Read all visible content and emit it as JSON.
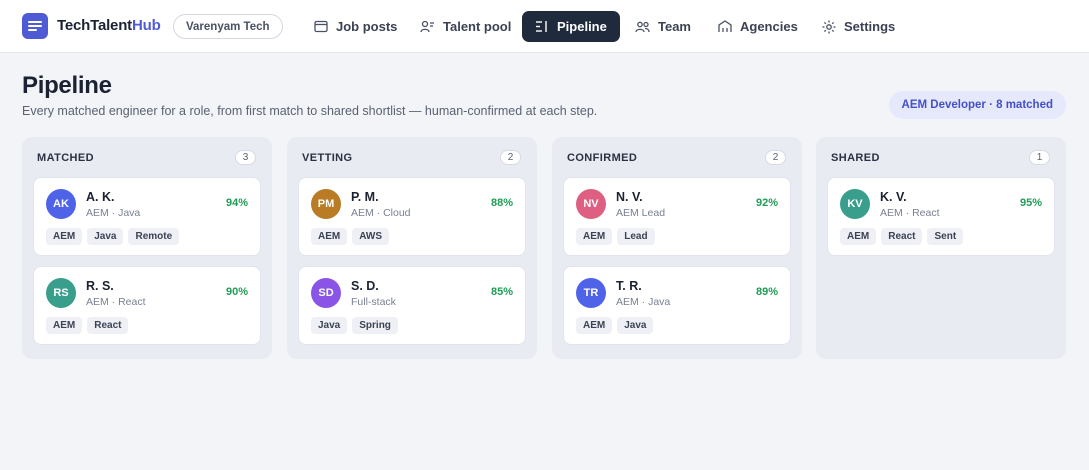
{
  "app": {
    "brand_main": "TechTalent",
    "brand_accent": "Hub",
    "org": "Varenyam Tech"
  },
  "nav": [
    {
      "label": "Job posts",
      "icon": "folder-icon"
    },
    {
      "label": "Talent pool",
      "icon": "users-icon"
    },
    {
      "label": "Pipeline",
      "icon": "pipeline-icon",
      "active": true
    },
    {
      "label": "Team",
      "icon": "team-icon"
    },
    {
      "label": "Agencies",
      "icon": "building-icon"
    },
    {
      "label": "Settings",
      "icon": "gear-icon"
    }
  ],
  "header": {
    "title": "Pipeline",
    "subtitle": "Every matched engineer for a role, from first match to shared shortlist — human-confirmed at each step.",
    "role_badge": "AEM Developer · 8 matched"
  },
  "colors": {
    "brand": "#4f5bd5",
    "nav_active": "#1f2a3d",
    "score": "#1f9d55"
  },
  "columns": [
    {
      "title": "MATCHED",
      "count": "3",
      "cards": [
        {
          "initials": "AK",
          "name": "A. K.",
          "role": "AEM · Java",
          "score": "94%",
          "avatar_color": "#4f63e8",
          "tags": [
            "AEM",
            "Java",
            "Remote"
          ]
        },
        {
          "initials": "RS",
          "name": "R. S.",
          "role": "AEM · React",
          "score": "90%",
          "avatar_color": "#3a9e8c",
          "tags": [
            "AEM",
            "React"
          ]
        }
      ]
    },
    {
      "title": "VETTING",
      "count": "2",
      "cards": [
        {
          "initials": "PM",
          "name": "P. M.",
          "role": "AEM · Cloud",
          "score": "88%",
          "avatar_color": "#b97c24",
          "tags": [
            "AEM",
            "AWS"
          ]
        },
        {
          "initials": "SD",
          "name": "S. D.",
          "role": "Full-stack",
          "score": "85%",
          "avatar_color": "#8a55e6",
          "tags": [
            "Java",
            "Spring"
          ]
        }
      ]
    },
    {
      "title": "CONFIRMED",
      "count": "2",
      "cards": [
        {
          "initials": "NV",
          "name": "N. V.",
          "role": "AEM Lead",
          "score": "92%",
          "avatar_color": "#df5f82",
          "tags": [
            "AEM",
            "Lead"
          ]
        },
        {
          "initials": "TR",
          "name": "T. R.",
          "role": "AEM · Java",
          "score": "89%",
          "avatar_color": "#4f63e8",
          "tags": [
            "AEM",
            "Java"
          ]
        }
      ]
    },
    {
      "title": "SHARED",
      "count": "1",
      "cards": [
        {
          "initials": "KV",
          "name": "K. V.",
          "role": "AEM · React",
          "score": "95%",
          "avatar_color": "#3a9e8c",
          "tags": [
            "AEM",
            "React",
            "Sent"
          ]
        }
      ]
    }
  ]
}
